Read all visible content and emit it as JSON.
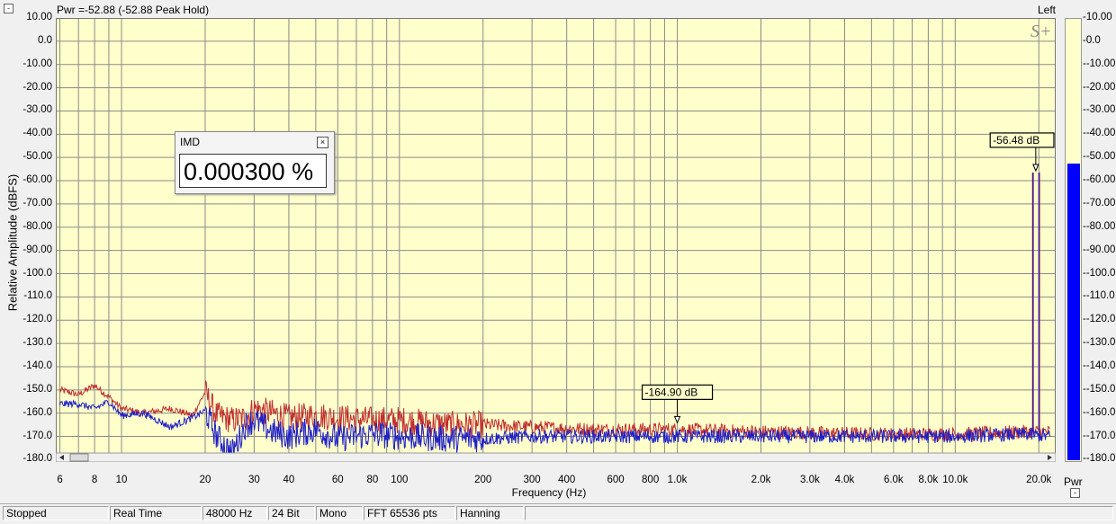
{
  "header": {
    "title": "Pwr =-52.88 (-52.88 Peak Hold)",
    "channel": "Left",
    "collapse": "-"
  },
  "imd": {
    "title": "IMD",
    "value": "0.000300 %",
    "close": "×"
  },
  "meter": {
    "label": "Pwr",
    "min_button": "-",
    "level_db": -52.88,
    "fill_color": "#0000ff"
  },
  "status": {
    "items": [
      "Stopped",
      "Real Time",
      "48000 Hz",
      "24 Bit",
      "Mono",
      "FFT 65536 pts",
      "Hanning"
    ]
  },
  "colors": {
    "plot_bg": "#ffffcc",
    "grid": "#8a8a8a",
    "series_blue": "#1f1fc8",
    "series_red": "#c03030"
  },
  "logo": "S+",
  "chart_data": {
    "type": "line",
    "title": "Pwr =-52.88 (-52.88 Peak Hold)",
    "xlabel": "Frequency (Hz)",
    "ylabel": "Relative Amplitude (dBFS)",
    "x_scale": "log",
    "xlim": [
      5.8,
      23000
    ],
    "ylim": [
      -181,
      10
    ],
    "grid": true,
    "y_ticks": [
      10,
      0,
      -10,
      -20,
      -30,
      -40,
      -50,
      -60,
      -70,
      -80,
      -90,
      -100,
      -110,
      -120,
      -130,
      -140,
      -150,
      -160,
      -170,
      -180
    ],
    "y_tick_labels": [
      "10.00",
      "0.0",
      "-10.00",
      "-20.00",
      "-30.00",
      "-40.00",
      "-50.00",
      "-60.00",
      "-70.00",
      "-80.00",
      "-90.00",
      "-100.0",
      "-110.0",
      "-120.0",
      "-130.0",
      "-140.0",
      "-150.0",
      "-160.0",
      "-170.0",
      "-180.0"
    ],
    "right_y_tick_labels": [
      "10.00",
      "0.0",
      "-10.00",
      "-20.00",
      "-30.00",
      "-40.00",
      "-50.00",
      "-60.00",
      "-70.00",
      "-80.00",
      "-90.00",
      "-100.0",
      "-110.0",
      "-120.0",
      "-130.0",
      "-140.0",
      "-150.0",
      "-160.0",
      "-170.0",
      "-180.0"
    ],
    "x_ticks": [
      6,
      8,
      10,
      20,
      30,
      40,
      60,
      80,
      100,
      200,
      300,
      400,
      600,
      800,
      1000,
      2000,
      3000,
      4000,
      6000,
      8000,
      10000,
      20000
    ],
    "x_tick_labels": [
      "6",
      "8",
      "10",
      "20",
      "30",
      "40",
      "60",
      "80",
      "100",
      "200",
      "300",
      "400",
      "600",
      "800",
      "1.0k",
      "2.0k",
      "3.0k",
      "4.0k",
      "6.0k",
      "8.0k",
      "10.0k",
      "20.0k"
    ],
    "series": [
      {
        "color": "#c03030",
        "x": [
          6,
          7,
          8,
          9,
          10,
          12,
          15,
          18,
          20,
          22,
          25,
          28,
          30,
          35,
          40,
          50,
          60,
          80,
          100,
          150,
          200,
          300,
          500,
          1000,
          2000,
          5000,
          10000,
          18000,
          19000,
          19500,
          20000,
          20500,
          21000,
          22000
        ],
        "y": [
          -150,
          -152,
          -148,
          -153,
          -158,
          -160,
          -158,
          -161,
          -151,
          -161,
          -163,
          -162,
          -158,
          -160,
          -162,
          -161,
          -162,
          -163,
          -163,
          -165,
          -165,
          -166,
          -167,
          -167,
          -168,
          -169,
          -169,
          -168,
          -56.5,
          -168,
          -56.5,
          -168,
          -168,
          -168
        ]
      },
      {
        "color": "#1f1fc8",
        "x": [
          6,
          7,
          8,
          9,
          10,
          12,
          15,
          18,
          20,
          22,
          25,
          28,
          30,
          35,
          40,
          50,
          60,
          80,
          100,
          150,
          200,
          300,
          500,
          1000,
          2000,
          5000,
          10000,
          18000,
          19000,
          19500,
          20000,
          20500,
          21000,
          22000
        ],
        "y": [
          -156,
          -156,
          -158,
          -155,
          -161,
          -160,
          -166,
          -162,
          -159,
          -170,
          -177,
          -165,
          -163,
          -168,
          -170,
          -167,
          -171,
          -169,
          -170,
          -171,
          -171,
          -170,
          -170,
          -170,
          -170,
          -170,
          -170,
          -169,
          -56.5,
          -170,
          -56.5,
          -169,
          -170,
          -170
        ]
      }
    ],
    "annotations": [
      {
        "text": "-56.48 dB",
        "x": 19500,
        "y": -56.48
      },
      {
        "text": "-164.90 dB",
        "x": 1000,
        "y": -164.9
      }
    ]
  }
}
